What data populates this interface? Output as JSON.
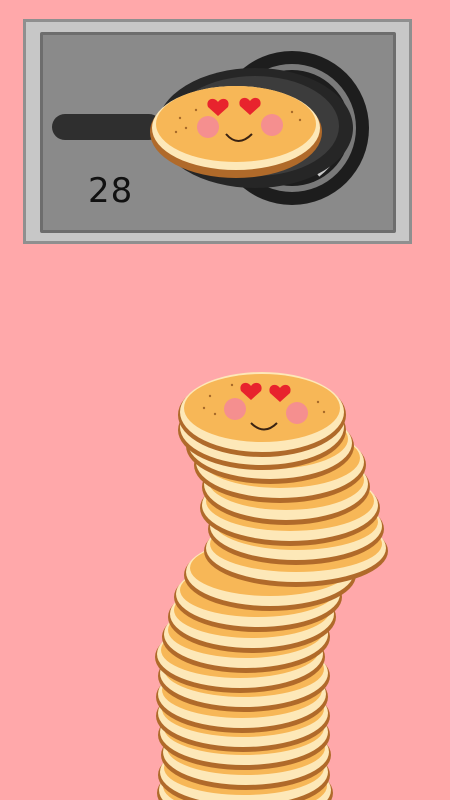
{
  "game": {
    "score": "28",
    "stack_count": 21
  },
  "colors": {
    "background": "#ffa8aa",
    "pancake_top": "#f7b757",
    "pancake_edge": "#fde8b8",
    "pancake_rim": "#b06a2a",
    "pan": "#2f2f2f",
    "burner": "#1a1a1a",
    "heart_eyes": "#e8232d",
    "cheeks": "#f58f8f"
  },
  "icons": {
    "pan": "frying-pan-icon",
    "face": "heart-eyes-face-icon"
  }
}
